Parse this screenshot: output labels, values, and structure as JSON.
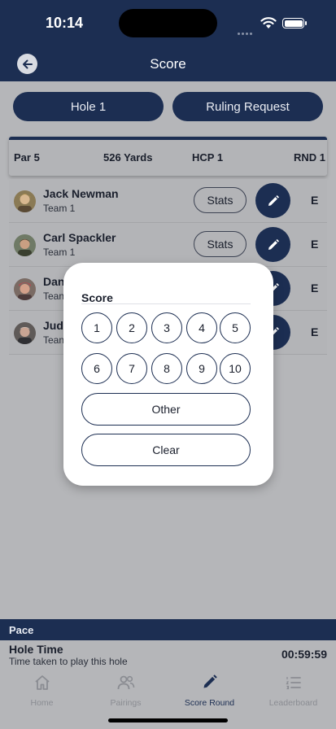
{
  "status": {
    "time": "10:14"
  },
  "nav": {
    "title": "Score"
  },
  "tabs": {
    "hole": "Hole 1",
    "ruling": "Ruling Request"
  },
  "info": {
    "par": "Par 5",
    "yards": "526 Yards",
    "hcp": "HCP 1",
    "round": "RND 1"
  },
  "players": [
    {
      "name": "Jack Newman",
      "team": "Team 1",
      "stats_label": "Stats",
      "score": "E"
    },
    {
      "name": "Carl Spackler",
      "team": "Team 1",
      "stats_label": "Stats",
      "score": "E"
    },
    {
      "name": "Dan",
      "team": "Tean",
      "score": "E"
    },
    {
      "name": "Jud",
      "team": "Tean",
      "score": "E"
    }
  ],
  "modal": {
    "title": "Score",
    "numbers": [
      "1",
      "2",
      "3",
      "4",
      "5",
      "6",
      "7",
      "8",
      "9",
      "10"
    ],
    "other_label": "Other",
    "clear_label": "Clear"
  },
  "pace": {
    "header": "Pace",
    "title": "Hole Time",
    "subtitle": "Time taken to play this hole",
    "timer": "00:59:59"
  },
  "tabbar": {
    "items": [
      {
        "label": "Home",
        "icon": "home-icon"
      },
      {
        "label": "Pairings",
        "icon": "people-icon"
      },
      {
        "label": "Score Round",
        "icon": "pencil-icon",
        "active": true
      },
      {
        "label": "Leaderboard",
        "icon": "list-icon"
      }
    ]
  },
  "colors": {
    "navy": "#1c2e52",
    "dim_background": "#b5b6b9",
    "modal": "#ffffff"
  }
}
